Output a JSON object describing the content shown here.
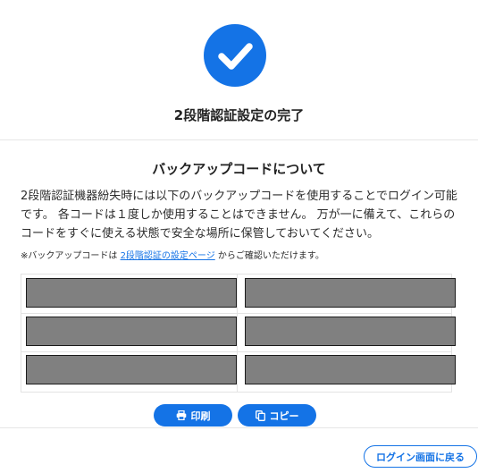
{
  "header": {
    "icon": "check-icon",
    "title": "2段階認証設定の完了"
  },
  "section": {
    "title": "バックアップコードについて",
    "description": "2段階認証機器紛失時には以下のバックアップコードを使用することでログイン可能です。 各コードは１度しか使用することはできません。 万が一に備えて、これらのコードをすぐに使える状態で安全な場所に保管しておいてください。",
    "note_prefix": "※バックアップコードは ",
    "note_link": "2段階認証の設定ページ",
    "note_suffix": " からご確認いただけます。"
  },
  "codes": {
    "count": 6,
    "masked": true
  },
  "actions": {
    "print_label": "印刷",
    "copy_label": "コピー",
    "back_label": "ログイン画面に戻る"
  },
  "colors": {
    "accent": "#1473e6",
    "masked_code": "#808080"
  }
}
